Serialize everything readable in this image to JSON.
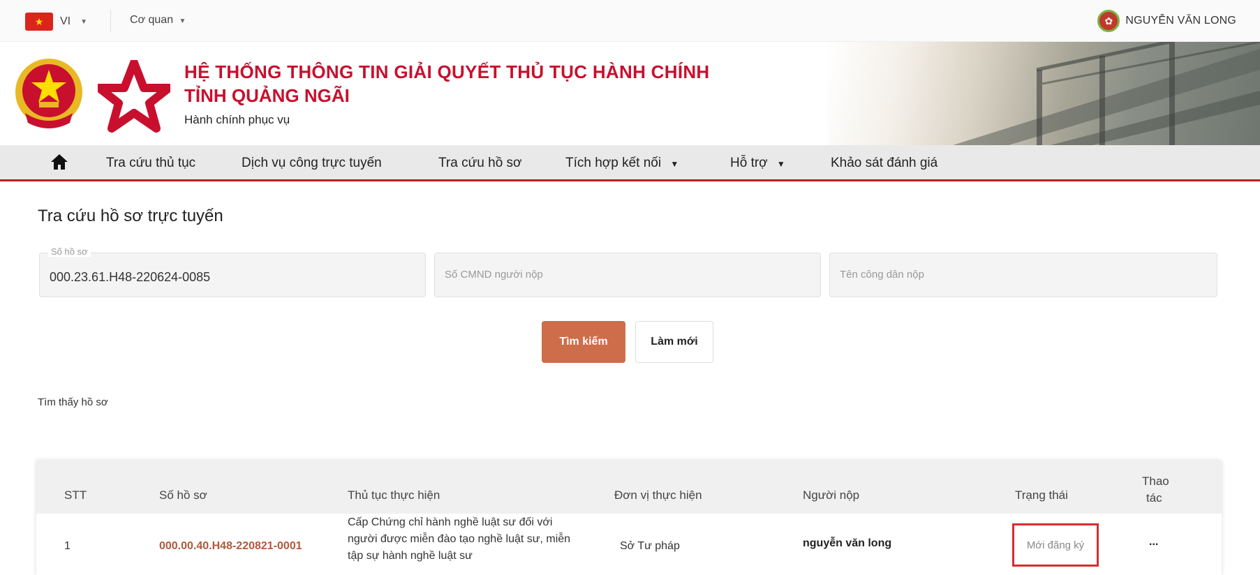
{
  "topbar": {
    "lang_code": "VI",
    "agency": "Cơ quan",
    "user_name": "NGUYỄN VĂN LONG"
  },
  "header": {
    "title_line1": "HỆ THỐNG THÔNG TIN GIẢI QUYẾT THỦ TỤC HÀNH CHÍNH",
    "title_line2": "TỈNH QUẢNG NGÃI",
    "subtitle": "Hành chính phục vụ"
  },
  "nav": {
    "items": [
      {
        "label": "Tra cứu thủ tục"
      },
      {
        "label": "Dịch vụ công trực tuyến"
      },
      {
        "label": "Tra cứu hồ sơ"
      },
      {
        "label": "Tích hợp kết nối"
      },
      {
        "label": "Hỗ trợ"
      },
      {
        "label": "Khảo sát đánh giá"
      }
    ]
  },
  "main": {
    "page_title": "Tra cứu hồ sơ trực tuyến",
    "fields": {
      "record_no_label": "Số hồ sơ",
      "record_no_value": "000.23.61.H48-220624-0085",
      "id_placeholder": "Số CMND người nộp",
      "name_placeholder": "Tên công dân nộp"
    },
    "search_label": "Tìm kiếm",
    "reset_label": "Làm mới",
    "found_text": "Tìm thấy hồ sơ"
  },
  "table": {
    "headers": {
      "stt": "STT",
      "record_no": "Số hồ sơ",
      "procedure": "Thủ tục thực hiện",
      "unit": "Đơn vị thực hiện",
      "submitter": "Người nộp",
      "status": "Trạng thái",
      "action_line1": "Thao",
      "action_line2": "tác"
    },
    "rows": [
      {
        "stt": "1",
        "record_no": "000.00.40.H48-220821-0001",
        "procedure_line1": "Cấp Chứng chỉ hành nghề luật sư đối với",
        "procedure_line2": "người được miễn đào tạo nghề luật sư, miễn",
        "procedure_line3": "tập sự hành nghề luật sư",
        "unit": "Sở Tư pháp",
        "submitter": "nguyễn văn long",
        "status": "Mới đăng ký",
        "action": "..."
      }
    ]
  },
  "colors": {
    "brand_red": "#c8102e",
    "nav_border": "#b71c1c",
    "search_button": "#cd6d4a",
    "status_highlight": "#d32f2f"
  }
}
